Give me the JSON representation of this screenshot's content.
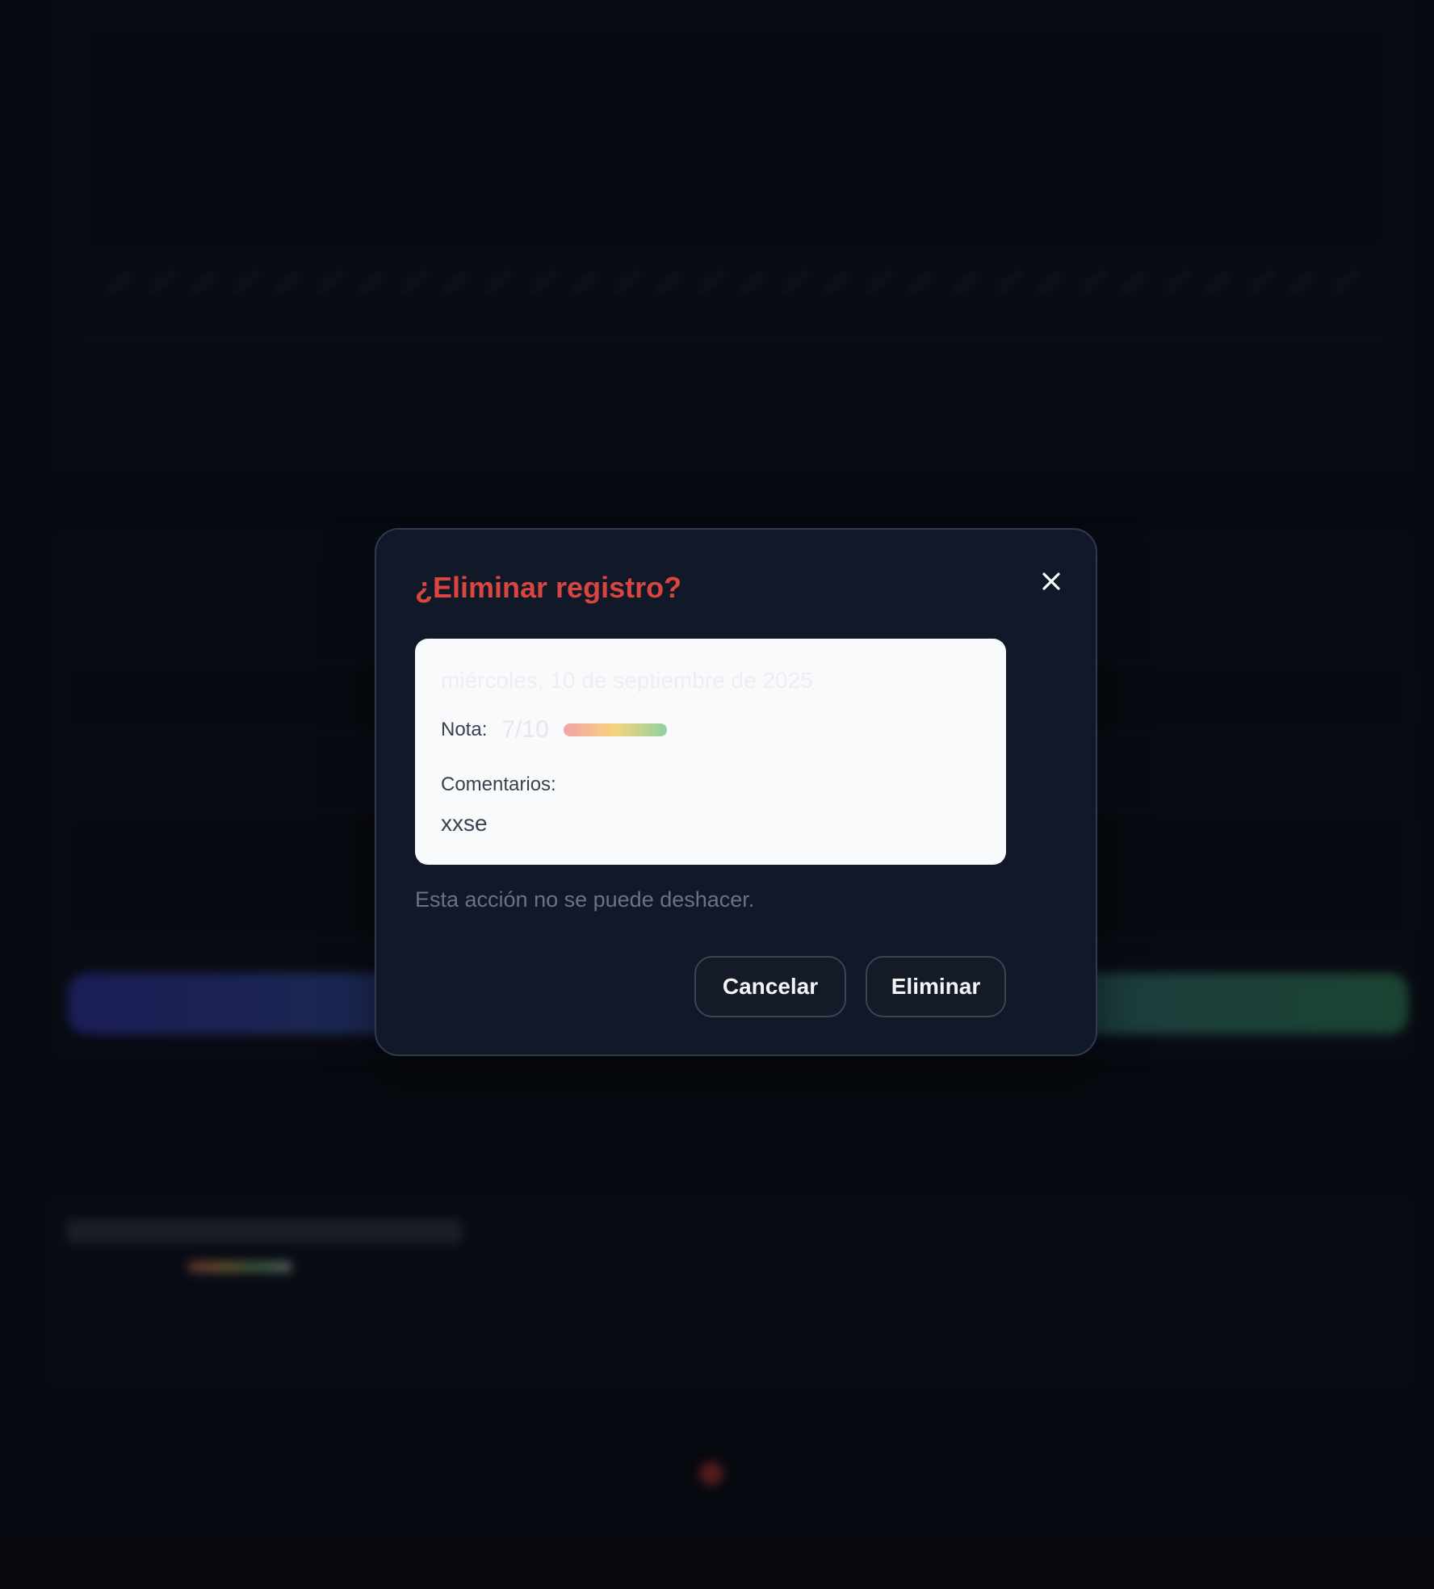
{
  "modal": {
    "title": "¿Eliminar registro?",
    "record_date": "miércoles, 10 de septiembre de 2025",
    "nota_label": "Nota:",
    "nota_value": "7/10",
    "nota_score": 0.7,
    "comments_label": "Comentarios:",
    "comments_value": "xxse",
    "warning": "Esta acción no se puede deshacer.",
    "cancel_label": "Cancelar",
    "delete_label": "Eliminar",
    "close_icon": "close-icon"
  },
  "colors": {
    "title_danger": "#d9453f",
    "modal_bg": "#111827",
    "summary_bg": "#f9fafb"
  }
}
